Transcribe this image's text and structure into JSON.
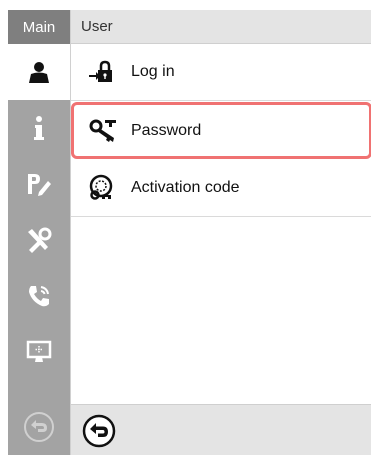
{
  "nav": {
    "header": "Main",
    "items": [
      {
        "icon": "user-icon",
        "active": true
      },
      {
        "icon": "info-icon",
        "active": false
      },
      {
        "icon": "edit-settings-icon",
        "active": false
      },
      {
        "icon": "tools-icon",
        "active": false
      },
      {
        "icon": "phone-icon",
        "active": false
      },
      {
        "icon": "monitor-icon",
        "active": false
      },
      {
        "icon": "back-icon",
        "active": false
      }
    ]
  },
  "panel": {
    "header": "User",
    "items": [
      {
        "label": "Log in",
        "icon": "login-lock-icon",
        "selected": false
      },
      {
        "label": "Password",
        "icon": "key-icon",
        "selected": true
      },
      {
        "label": "Activation code",
        "icon": "activation-key-icon",
        "selected": false
      }
    ]
  },
  "footer": {
    "back_icon": "back-arrow-icon"
  },
  "colors": {
    "nav_bg": "#a3a3a3",
    "nav_header": "#7f7f7f",
    "selection_border": "#f07272",
    "panel_header": "#e4e4e4"
  }
}
